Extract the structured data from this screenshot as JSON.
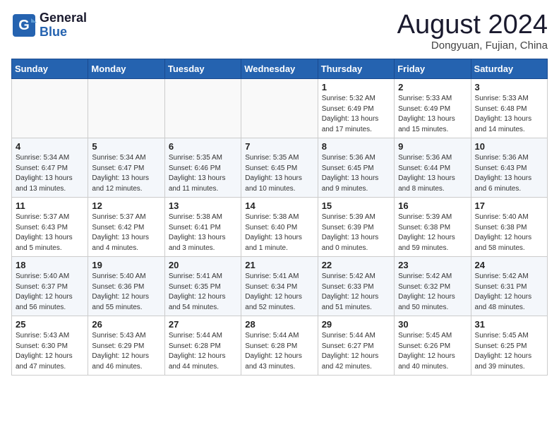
{
  "header": {
    "logo_line1": "General",
    "logo_line2": "Blue",
    "month": "August 2024",
    "location": "Dongyuan, Fujian, China"
  },
  "weekdays": [
    "Sunday",
    "Monday",
    "Tuesday",
    "Wednesday",
    "Thursday",
    "Friday",
    "Saturday"
  ],
  "weeks": [
    [
      {
        "day": "",
        "info": ""
      },
      {
        "day": "",
        "info": ""
      },
      {
        "day": "",
        "info": ""
      },
      {
        "day": "",
        "info": ""
      },
      {
        "day": "1",
        "info": "Sunrise: 5:32 AM\nSunset: 6:49 PM\nDaylight: 13 hours\nand 17 minutes."
      },
      {
        "day": "2",
        "info": "Sunrise: 5:33 AM\nSunset: 6:49 PM\nDaylight: 13 hours\nand 15 minutes."
      },
      {
        "day": "3",
        "info": "Sunrise: 5:33 AM\nSunset: 6:48 PM\nDaylight: 13 hours\nand 14 minutes."
      }
    ],
    [
      {
        "day": "4",
        "info": "Sunrise: 5:34 AM\nSunset: 6:47 PM\nDaylight: 13 hours\nand 13 minutes."
      },
      {
        "day": "5",
        "info": "Sunrise: 5:34 AM\nSunset: 6:47 PM\nDaylight: 13 hours\nand 12 minutes."
      },
      {
        "day": "6",
        "info": "Sunrise: 5:35 AM\nSunset: 6:46 PM\nDaylight: 13 hours\nand 11 minutes."
      },
      {
        "day": "7",
        "info": "Sunrise: 5:35 AM\nSunset: 6:45 PM\nDaylight: 13 hours\nand 10 minutes."
      },
      {
        "day": "8",
        "info": "Sunrise: 5:36 AM\nSunset: 6:45 PM\nDaylight: 13 hours\nand 9 minutes."
      },
      {
        "day": "9",
        "info": "Sunrise: 5:36 AM\nSunset: 6:44 PM\nDaylight: 13 hours\nand 8 minutes."
      },
      {
        "day": "10",
        "info": "Sunrise: 5:36 AM\nSunset: 6:43 PM\nDaylight: 13 hours\nand 6 minutes."
      }
    ],
    [
      {
        "day": "11",
        "info": "Sunrise: 5:37 AM\nSunset: 6:43 PM\nDaylight: 13 hours\nand 5 minutes."
      },
      {
        "day": "12",
        "info": "Sunrise: 5:37 AM\nSunset: 6:42 PM\nDaylight: 13 hours\nand 4 minutes."
      },
      {
        "day": "13",
        "info": "Sunrise: 5:38 AM\nSunset: 6:41 PM\nDaylight: 13 hours\nand 3 minutes."
      },
      {
        "day": "14",
        "info": "Sunrise: 5:38 AM\nSunset: 6:40 PM\nDaylight: 13 hours\nand 1 minute."
      },
      {
        "day": "15",
        "info": "Sunrise: 5:39 AM\nSunset: 6:39 PM\nDaylight: 13 hours\nand 0 minutes."
      },
      {
        "day": "16",
        "info": "Sunrise: 5:39 AM\nSunset: 6:38 PM\nDaylight: 12 hours\nand 59 minutes."
      },
      {
        "day": "17",
        "info": "Sunrise: 5:40 AM\nSunset: 6:38 PM\nDaylight: 12 hours\nand 58 minutes."
      }
    ],
    [
      {
        "day": "18",
        "info": "Sunrise: 5:40 AM\nSunset: 6:37 PM\nDaylight: 12 hours\nand 56 minutes."
      },
      {
        "day": "19",
        "info": "Sunrise: 5:40 AM\nSunset: 6:36 PM\nDaylight: 12 hours\nand 55 minutes."
      },
      {
        "day": "20",
        "info": "Sunrise: 5:41 AM\nSunset: 6:35 PM\nDaylight: 12 hours\nand 54 minutes."
      },
      {
        "day": "21",
        "info": "Sunrise: 5:41 AM\nSunset: 6:34 PM\nDaylight: 12 hours\nand 52 minutes."
      },
      {
        "day": "22",
        "info": "Sunrise: 5:42 AM\nSunset: 6:33 PM\nDaylight: 12 hours\nand 51 minutes."
      },
      {
        "day": "23",
        "info": "Sunrise: 5:42 AM\nSunset: 6:32 PM\nDaylight: 12 hours\nand 50 minutes."
      },
      {
        "day": "24",
        "info": "Sunrise: 5:42 AM\nSunset: 6:31 PM\nDaylight: 12 hours\nand 48 minutes."
      }
    ],
    [
      {
        "day": "25",
        "info": "Sunrise: 5:43 AM\nSunset: 6:30 PM\nDaylight: 12 hours\nand 47 minutes."
      },
      {
        "day": "26",
        "info": "Sunrise: 5:43 AM\nSunset: 6:29 PM\nDaylight: 12 hours\nand 46 minutes."
      },
      {
        "day": "27",
        "info": "Sunrise: 5:44 AM\nSunset: 6:28 PM\nDaylight: 12 hours\nand 44 minutes."
      },
      {
        "day": "28",
        "info": "Sunrise: 5:44 AM\nSunset: 6:28 PM\nDaylight: 12 hours\nand 43 minutes."
      },
      {
        "day": "29",
        "info": "Sunrise: 5:44 AM\nSunset: 6:27 PM\nDaylight: 12 hours\nand 42 minutes."
      },
      {
        "day": "30",
        "info": "Sunrise: 5:45 AM\nSunset: 6:26 PM\nDaylight: 12 hours\nand 40 minutes."
      },
      {
        "day": "31",
        "info": "Sunrise: 5:45 AM\nSunset: 6:25 PM\nDaylight: 12 hours\nand 39 minutes."
      }
    ]
  ]
}
